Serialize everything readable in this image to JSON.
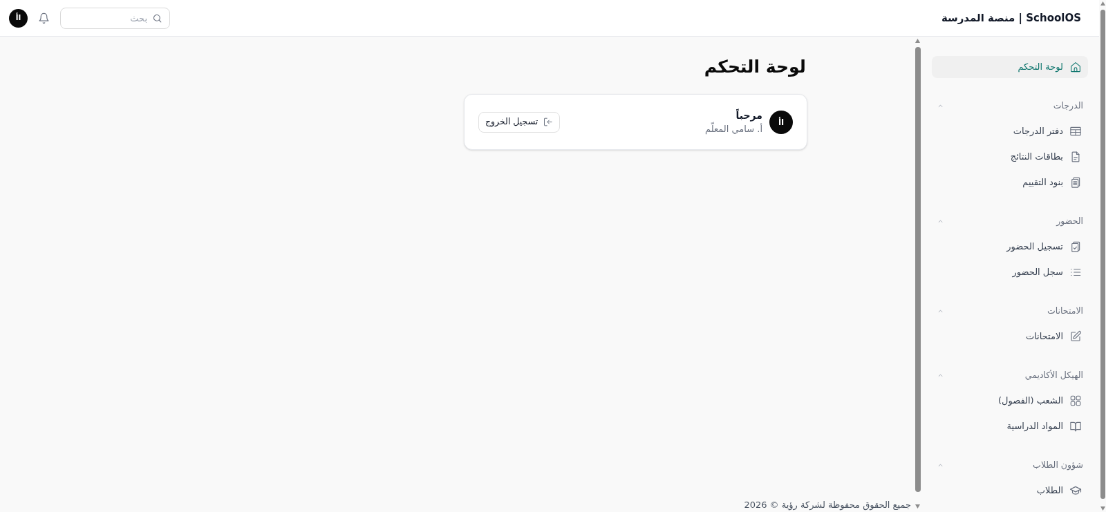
{
  "header": {
    "title": "SchoolOS | منصة المدرسة",
    "search": {
      "placeholder": "بحث"
    },
    "avatar": "اأ"
  },
  "sidebar": {
    "items": [
      {
        "label": "لوحة التحكم",
        "selected": true
      }
    ],
    "sections": [
      {
        "title": "الدرجات",
        "expanded": true,
        "items": [
          {
            "label": "دفتر الدرجات",
            "selected": false
          },
          {
            "label": "بطاقات النتائج",
            "selected": false
          },
          {
            "label": "بنود التقييم",
            "selected": false
          }
        ]
      },
      {
        "title": "الحضور",
        "expanded": true,
        "items": [
          {
            "label": "تسجيل الحضور",
            "selected": false
          },
          {
            "label": "سجل الحضور",
            "selected": false
          }
        ]
      },
      {
        "title": "الامتحانات",
        "expanded": true,
        "items": [
          {
            "label": "الامتحانات",
            "selected": false
          }
        ]
      },
      {
        "title": "الهيكل الأكاديمي",
        "expanded": true,
        "items": [
          {
            "label": "الشعب (الفصول)",
            "selected": false
          },
          {
            "label": "المواد الدراسية",
            "selected": false
          }
        ]
      },
      {
        "title": "شؤون الطلاب",
        "expanded": true,
        "items": [
          {
            "label": "الطلاب",
            "selected": false
          }
        ]
      }
    ]
  },
  "main": {
    "title": "لوحة التحكم",
    "welcome_card": {
      "avatar": "اأ",
      "greeting": "مرحباً",
      "name": "أ. سامي المعلّم",
      "logout_button": "تسجيل الخروج"
    }
  },
  "footer": {
    "text": "جميع الحقوق محفوظة لشركة رؤية © 2026"
  }
}
